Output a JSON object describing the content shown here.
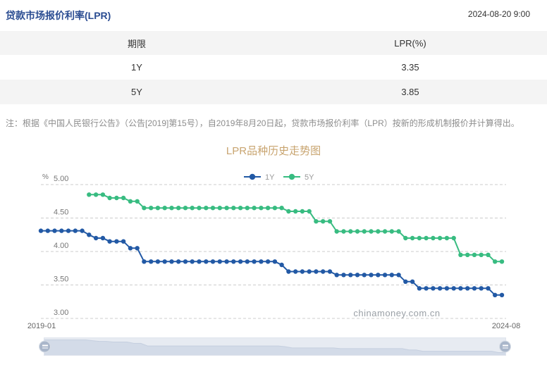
{
  "header": {
    "title": "贷款市场报价利率(LPR)",
    "datetime": "2024-08-20 9:00"
  },
  "table": {
    "columns": [
      "期限",
      "LPR(%)"
    ],
    "rows": [
      [
        "1Y",
        "3.35"
      ],
      [
        "5Y",
        "3.85"
      ]
    ]
  },
  "note": "注：根据《中国人民银行公告》（公告[2019]第15号），自2019年8月20日起，贷款市场报价利率（LPR）按新的形成机制报价并计算得出。",
  "chart_data": {
    "type": "line",
    "title": "LPR品种历史走势图",
    "ylabel": "%",
    "ylim": [
      3.0,
      5.0
    ],
    "yticks": [
      "5.00",
      "4.50",
      "4.00",
      "3.50",
      "3.00"
    ],
    "grid": "dashed-horizontal",
    "legend_position": "top-center",
    "watermark": "chinamoney.com.cn",
    "x_axis_labels_shown": [
      "2019-01",
      "2024-08"
    ],
    "x": [
      "2019-01",
      "2019-02",
      "2019-03",
      "2019-04",
      "2019-05",
      "2019-06",
      "2019-07",
      "2019-08",
      "2019-09",
      "2019-10",
      "2019-11",
      "2019-12",
      "2020-01",
      "2020-02",
      "2020-03",
      "2020-04",
      "2020-05",
      "2020-06",
      "2020-07",
      "2020-08",
      "2020-09",
      "2020-10",
      "2020-11",
      "2020-12",
      "2021-01",
      "2021-02",
      "2021-03",
      "2021-04",
      "2021-05",
      "2021-06",
      "2021-07",
      "2021-08",
      "2021-09",
      "2021-10",
      "2021-11",
      "2021-12",
      "2022-01",
      "2022-02",
      "2022-03",
      "2022-04",
      "2022-05",
      "2022-06",
      "2022-07",
      "2022-08",
      "2022-09",
      "2022-10",
      "2022-11",
      "2022-12",
      "2023-01",
      "2023-02",
      "2023-03",
      "2023-04",
      "2023-05",
      "2023-06",
      "2023-07",
      "2023-08",
      "2023-09",
      "2023-10",
      "2023-11",
      "2023-12",
      "2024-01",
      "2024-02",
      "2024-03",
      "2024-04",
      "2024-05",
      "2024-06",
      "2024-07",
      "2024-08"
    ],
    "series": [
      {
        "name": "1Y",
        "color": "#2259a5",
        "values": [
          4.31,
          4.31,
          4.31,
          4.31,
          4.31,
          4.31,
          4.31,
          4.25,
          4.2,
          4.2,
          4.15,
          4.15,
          4.15,
          4.05,
          4.05,
          3.85,
          3.85,
          3.85,
          3.85,
          3.85,
          3.85,
          3.85,
          3.85,
          3.85,
          3.85,
          3.85,
          3.85,
          3.85,
          3.85,
          3.85,
          3.85,
          3.85,
          3.85,
          3.85,
          3.85,
          3.8,
          3.7,
          3.7,
          3.7,
          3.7,
          3.7,
          3.7,
          3.7,
          3.65,
          3.65,
          3.65,
          3.65,
          3.65,
          3.65,
          3.65,
          3.65,
          3.65,
          3.65,
          3.55,
          3.55,
          3.45,
          3.45,
          3.45,
          3.45,
          3.45,
          3.45,
          3.45,
          3.45,
          3.45,
          3.45,
          3.45,
          3.35,
          3.35
        ]
      },
      {
        "name": "5Y",
        "color": "#38bc81",
        "values": [
          null,
          null,
          null,
          null,
          null,
          null,
          null,
          4.85,
          4.85,
          4.85,
          4.8,
          4.8,
          4.8,
          4.75,
          4.75,
          4.65,
          4.65,
          4.65,
          4.65,
          4.65,
          4.65,
          4.65,
          4.65,
          4.65,
          4.65,
          4.65,
          4.65,
          4.65,
          4.65,
          4.65,
          4.65,
          4.65,
          4.65,
          4.65,
          4.65,
          4.65,
          4.6,
          4.6,
          4.6,
          4.6,
          4.45,
          4.45,
          4.45,
          4.3,
          4.3,
          4.3,
          4.3,
          4.3,
          4.3,
          4.3,
          4.3,
          4.3,
          4.3,
          4.2,
          4.2,
          4.2,
          4.2,
          4.2,
          4.2,
          4.2,
          4.2,
          3.95,
          3.95,
          3.95,
          3.95,
          3.95,
          3.85,
          3.85
        ]
      }
    ]
  },
  "colors": {
    "header_title": "#2b4d92",
    "chart_title": "#c8a46f",
    "row_stripe": "#f4f4f4",
    "gridline": "#cccccc",
    "axis_label": "#666666",
    "watermark": "#9aa0a6",
    "slider_track": "#e7ebf2",
    "slider_silhouette": "#d3dbe8",
    "slider_handle": "#a9b6ca"
  }
}
